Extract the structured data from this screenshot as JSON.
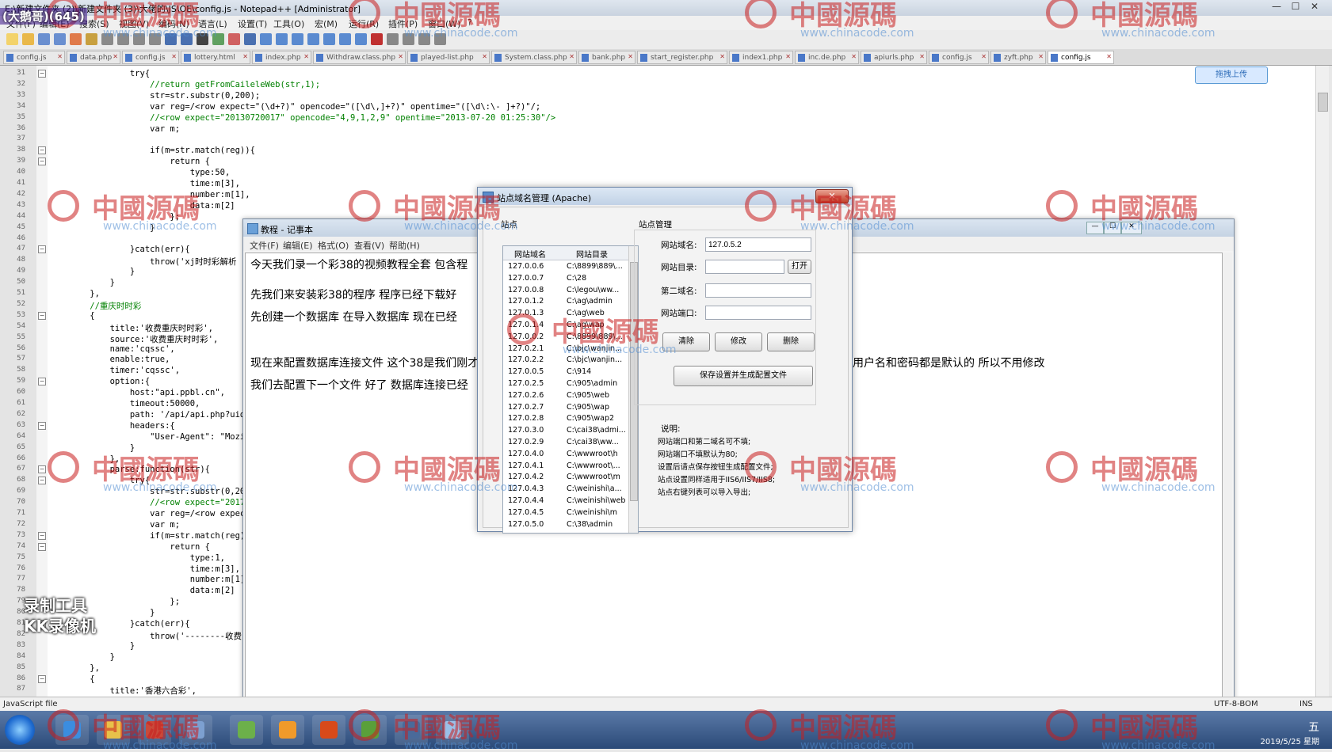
{
  "npp": {
    "title": "E:\\新建文件夹 (2)\\新建文件夹 (3)\\大佬的\\JS\\OE\\config.js - Notepad++ [Administrator]",
    "menu": [
      "文件(F)",
      "编辑(E)",
      "搜索(S)",
      "视图(V)",
      "编码(N)",
      "语言(L)",
      "设置(T)",
      "工具(O)",
      "宏(M)",
      "运行(R)",
      "插件(P)",
      "窗口(W)",
      "?"
    ],
    "tabs": [
      "config.js",
      "data.php",
      "config.js",
      "lottery.html",
      "index.php",
      "Withdraw.class.php",
      "played-list.php",
      "System.class.php",
      "bank.php",
      "start_register.php",
      "index1.php",
      "inc.de.php",
      "apiurls.php",
      "config.js",
      "zyft.php",
      "config.js"
    ],
    "active_tab": 15,
    "upload_label": "拖拽上传",
    "status_left": "JavaScript file",
    "status_bom": "UTF-8-BOM",
    "status_ins": "INS"
  },
  "lines": [
    {
      "n": "31",
      "t": "            try{"
    },
    {
      "n": "32",
      "t": "                //return getFromCaileleWeb(str,1);"
    },
    {
      "n": "33",
      "t": "                str=str.substr(0,200);"
    },
    {
      "n": "34",
      "t": "                var reg=/<row expect=\"(\\d+?)\" opencode=\"([\\d\\,]+?)\" opentime=\"([\\d\\:\\- ]+?)\"/;"
    },
    {
      "n": "35",
      "t": "                //<row expect=\"20130720017\" opencode=\"4,9,1,2,9\" opentime=\"2013-07-20 01:25:30\"/>"
    },
    {
      "n": "36",
      "t": "                var m;"
    },
    {
      "n": "37",
      "t": ""
    },
    {
      "n": "38",
      "t": "                if(m=str.match(reg)){"
    },
    {
      "n": "39",
      "t": "                    return {"
    },
    {
      "n": "40",
      "t": "                        type:50,"
    },
    {
      "n": "41",
      "t": "                        time:m[3],"
    },
    {
      "n": "42",
      "t": "                        number:m[1],"
    },
    {
      "n": "43",
      "t": "                        data:m[2]"
    },
    {
      "n": "44",
      "t": "                    };"
    },
    {
      "n": "45",
      "t": "                }"
    },
    {
      "n": "46",
      "t": ""
    },
    {
      "n": "47",
      "t": "            }catch(err){"
    },
    {
      "n": "48",
      "t": "                throw('xj时时彩解析"
    },
    {
      "n": "49",
      "t": "            }"
    },
    {
      "n": "50",
      "t": "        }"
    },
    {
      "n": "51",
      "t": "    },"
    },
    {
      "n": "52",
      "t": "    //重庆时时彩"
    },
    {
      "n": "53",
      "t": "    {"
    },
    {
      "n": "54",
      "t": "        title:'收费重庆时时彩',"
    },
    {
      "n": "55",
      "t": "        source:'收费重庆时时彩',"
    },
    {
      "n": "56",
      "t": "        name:'cqssc',"
    },
    {
      "n": "57",
      "t": "        enable:true,"
    },
    {
      "n": "58",
      "t": "        timer:'cqssc',"
    },
    {
      "n": "59",
      "t": "        option:{"
    },
    {
      "n": "60",
      "t": "            host:\"api.ppbl.cn\","
    },
    {
      "n": "61",
      "t": "            timeout:50000,"
    },
    {
      "n": "62",
      "t": "            path: '/api/api.php?uid"
    },
    {
      "n": "63",
      "t": "            headers:{"
    },
    {
      "n": "64",
      "t": "                \"User-Agent\": \"Mozi"
    },
    {
      "n": "65",
      "t": "            }"
    },
    {
      "n": "66",
      "t": "        },"
    },
    {
      "n": "67",
      "t": "        parse:function(str){"
    },
    {
      "n": "68",
      "t": "            try{"
    },
    {
      "n": "69",
      "t": "                str=str.substr(0,20"
    },
    {
      "n": "70",
      "t": "                //<row expect=\"2017"
    },
    {
      "n": "71",
      "t": "                var reg=/<row expec"
    },
    {
      "n": "72",
      "t": "                var m;"
    },
    {
      "n": "73",
      "t": "                if(m=str.match(reg)"
    },
    {
      "n": "74",
      "t": "                    return {"
    },
    {
      "n": "75",
      "t": "                        type:1,"
    },
    {
      "n": "76",
      "t": "                        time:m[3],"
    },
    {
      "n": "77",
      "t": "                        number:m[1]"
    },
    {
      "n": "78",
      "t": "                        data:m[2]"
    },
    {
      "n": "79",
      "t": "                    };"
    },
    {
      "n": "80",
      "t": "                }"
    },
    {
      "n": "81",
      "t": "            }catch(err){"
    },
    {
      "n": "82",
      "t": "                throw('--------收费"
    },
    {
      "n": "83",
      "t": "            }"
    },
    {
      "n": "84",
      "t": "        }"
    },
    {
      "n": "85",
      "t": "    },"
    },
    {
      "n": "86",
      "t": "    {"
    },
    {
      "n": "87",
      "t": "        title:'香港六合彩',"
    }
  ],
  "notepad": {
    "title": "教程 - 记事本",
    "menu": [
      "文件(F)",
      "编辑(E)",
      "格式(O)",
      "查看(V)",
      "帮助(H)"
    ],
    "lines": [
      "今天我们录一个彩38的视频教程全套    包含程",
      "先我们来安装彩38的程序       程序已经下载好",
      "先创建一个数据库      在导入数据库      现在已经",
      "现在来配置数据库连接文件     这个38是我们刚才",
      "我们去配置下一个文件     好了     数据库连接已经"
    ],
    "line_tail": "用户名和密码都是默认的     所以不用修改"
  },
  "dialog": {
    "title": "站点域名管理 (Apache)",
    "close": "✕",
    "list_group": "站点",
    "col_domain": "网站域名",
    "col_dir": "网站目录",
    "rows": [
      [
        "127.0.0.6",
        "C:\\8899\\889\\..."
      ],
      [
        "127.0.0.7",
        "C:\\28"
      ],
      [
        "127.0.0.8",
        "C:\\legou\\ww..."
      ],
      [
        "127.0.1.2",
        "C:\\ag\\admin"
      ],
      [
        "127.0.1.3",
        "C:\\ag\\web"
      ],
      [
        "127.0.1.4",
        "C:\\ag\\wap"
      ],
      [
        "127.0.0.2",
        "C:\\8899\\889\\..."
      ],
      [
        "127.0.2.1",
        "C:\\bjc\\wanjin..."
      ],
      [
        "127.0.2.2",
        "C:\\bjc\\wanjin..."
      ],
      [
        "127.0.0.5",
        "C:\\914"
      ],
      [
        "127.0.2.5",
        "C:\\905\\admin"
      ],
      [
        "127.0.2.6",
        "C:\\905\\web"
      ],
      [
        "127.0.2.7",
        "C:\\905\\wap"
      ],
      [
        "127.0.2.8",
        "C:\\905\\wap2"
      ],
      [
        "127.0.3.0",
        "C:\\cai38\\admi..."
      ],
      [
        "127.0.2.9",
        "C:\\cai38\\ww..."
      ],
      [
        "127.0.4.0",
        "C:\\wwwroot\\h"
      ],
      [
        "127.0.4.1",
        "C:\\wwwroot\\..."
      ],
      [
        "127.0.4.2",
        "C:\\wwwroot\\m"
      ],
      [
        "127.0.4.3",
        "C:\\weinishi\\a..."
      ],
      [
        "127.0.4.4",
        "C:\\weinishi\\web"
      ],
      [
        "127.0.4.5",
        "C:\\weinishi\\m"
      ],
      [
        "127.0.5.0",
        "C:\\38\\admin"
      ]
    ],
    "mgmt_group": "站点管理",
    "domain_label": "网站域名:",
    "domain_value": "127.0.5.2",
    "dir_label": "网站目录:",
    "open_button": "打开",
    "alias_label": "第二域名:",
    "port_label": "网站端口:",
    "clear_button": "清除",
    "modify_button": "修改",
    "delete_button": "删除",
    "save_button": "保存设置并生成配置文件",
    "notes_title": "说明:",
    "notes": [
      "网站端口和第二域名可不填;",
      "网站端口不填默认为80;",
      "设置后请点保存按钮生成配置文件;",
      "站点设置同样适用于IIS6/IIS7/IIS8;",
      "站点右键列表可以导入导出;"
    ]
  },
  "overlay": {
    "watermark_text": "中國源碼",
    "watermark_url": "www.chinacode.com",
    "recorder": [
      "录制工具",
      "KK录像机"
    ],
    "corner_badge": "(大鹅哥)(645)"
  },
  "taskbar": {
    "clock_time": "五",
    "clock_date": "2019/5/25 星期"
  },
  "colors": {
    "keyword": "#00008b",
    "comment": "#008000",
    "number": "#ff0000",
    "string": "#808080",
    "watermark": "#c81e1e"
  }
}
